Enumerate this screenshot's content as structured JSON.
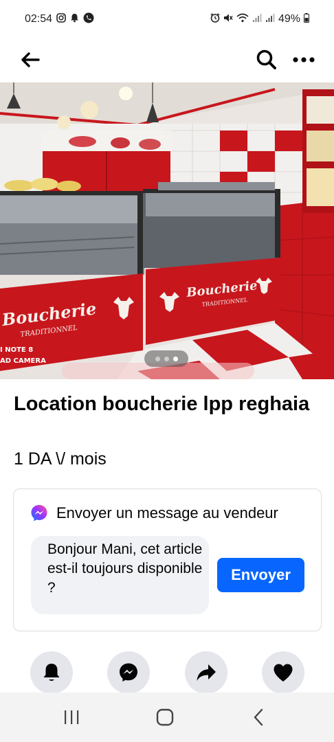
{
  "status_bar": {
    "time": "02:54",
    "battery": "49%",
    "left_icons": [
      "instagram-icon",
      "notification-bell-icon",
      "whatsapp-icon"
    ],
    "right_icons": [
      "alarm-icon",
      "mute-icon",
      "wifi-icon",
      "signal-icon",
      "signal-icon",
      "battery-icon"
    ]
  },
  "nav": {
    "back_icon": "arrow-left-icon",
    "search_icon": "search-icon",
    "more_icon": "more-dots-icon"
  },
  "hero": {
    "sign_top_left": "Boucherie",
    "sign_top_left_sub": "TRADITIONNEL",
    "sign_top_right": "Boucherie",
    "sign_top_right_sub": "TRADITIONNEL",
    "watermark_line1": "I NOTE 8",
    "watermark_line2": "AD CAMERA",
    "carousel_count": 3,
    "carousel_active_index": 2
  },
  "listing": {
    "title": "Location boucherie lpp reghaia",
    "price": "1 DA \\/ mois"
  },
  "message_card": {
    "heading": "Envoyer un message au vendeur",
    "icon": "messenger-icon",
    "message_text": "Bonjour Mani, cet article est-il toujours disponible ?",
    "send_label": "Envoyer"
  },
  "actions": [
    {
      "name": "bell-icon"
    },
    {
      "name": "messenger-icon"
    },
    {
      "name": "share-icon"
    },
    {
      "name": "heart-icon"
    }
  ],
  "android_nav": {
    "recents_icon": "recents-icon",
    "home_icon": "home-icon",
    "back_icon": "back-chevron-icon"
  },
  "colors": {
    "accent": "#0866ff",
    "card_border": "#dcdde1",
    "bubble_bg": "#f0f2f5",
    "action_bg": "#e4e6eb",
    "shop_red": "#c8161d"
  }
}
